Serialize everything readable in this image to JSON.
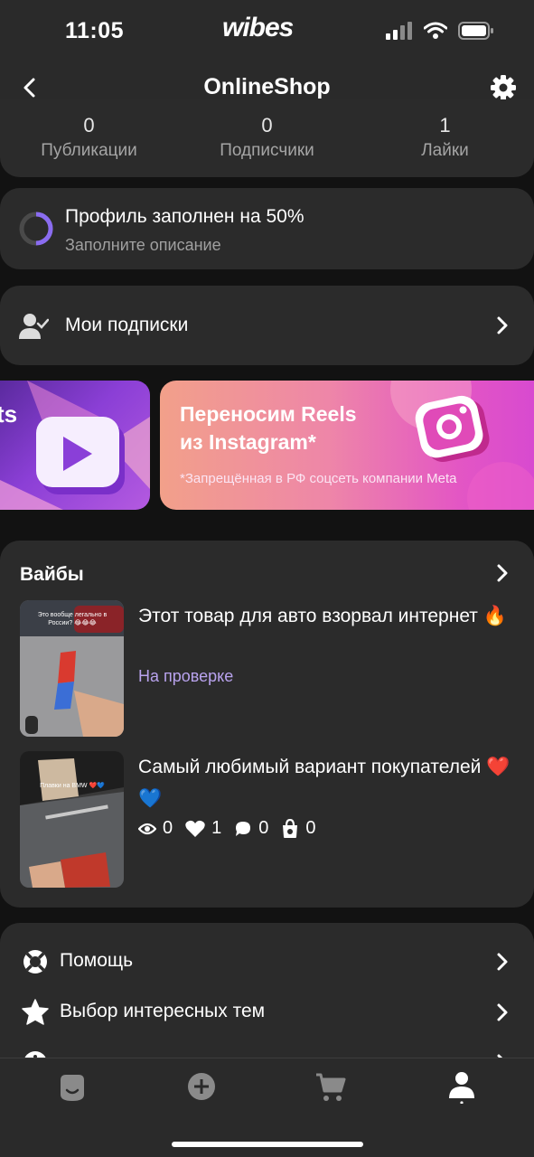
{
  "status_bar": {
    "time": "11:05",
    "logo": "wibes"
  },
  "header": {
    "title": "OnlineShop",
    "back_icon": "chevron-left-icon",
    "settings_icon": "gear-icon"
  },
  "stats": [
    {
      "value": "0",
      "label": "Публикации"
    },
    {
      "value": "0",
      "label": "Подписчики"
    },
    {
      "value": "1",
      "label": "Лайки"
    }
  ],
  "profile_progress": {
    "title": "Профиль заполнен на 50%",
    "subtitle": "Заполните описание",
    "percent": 50,
    "accent": "#8a6cf0"
  },
  "subscriptions": {
    "label": "Мои подписки",
    "icon": "user-check-icon"
  },
  "banners": [
    {
      "partial_text": "ts",
      "icon": "play-icon"
    },
    {
      "title_line1": "Переносим Reels",
      "title_line2": "из Instagram*",
      "note": "*Запрещённая в РФ соцсеть компании Meta",
      "icon": "instagram-icon"
    }
  ],
  "vibes": {
    "title": "Вайбы",
    "posts": [
      {
        "title": "Этот товар для авто взорвал интернет 🔥",
        "status": "На проверке",
        "thumb_caption": "Это вообще легально в России? 😂😂😂"
      },
      {
        "title": "Самый любимый вариант покупателей ❤️💙",
        "thumb_caption": "Плавки на BMW ❤️💙",
        "metrics": {
          "views": "0",
          "likes": "1",
          "comments": "0",
          "purchases": "0"
        }
      }
    ]
  },
  "menu": [
    {
      "label": "Помощь",
      "icon": "lifebuoy-icon"
    },
    {
      "label": "Выбор интересных тем",
      "icon": "star-icon"
    },
    {
      "label": "",
      "icon": "info-icon"
    }
  ],
  "tabs": [
    {
      "name": "feed",
      "icon": "smile-face-icon"
    },
    {
      "name": "create",
      "icon": "plus-circle-icon"
    },
    {
      "name": "cart",
      "icon": "cart-icon"
    },
    {
      "name": "profile",
      "icon": "user-icon"
    }
  ],
  "colors": {
    "background": "#121212",
    "card": "#2b2b2b",
    "accent": "#8a6cf0",
    "status_review": "#b9a3ee"
  }
}
